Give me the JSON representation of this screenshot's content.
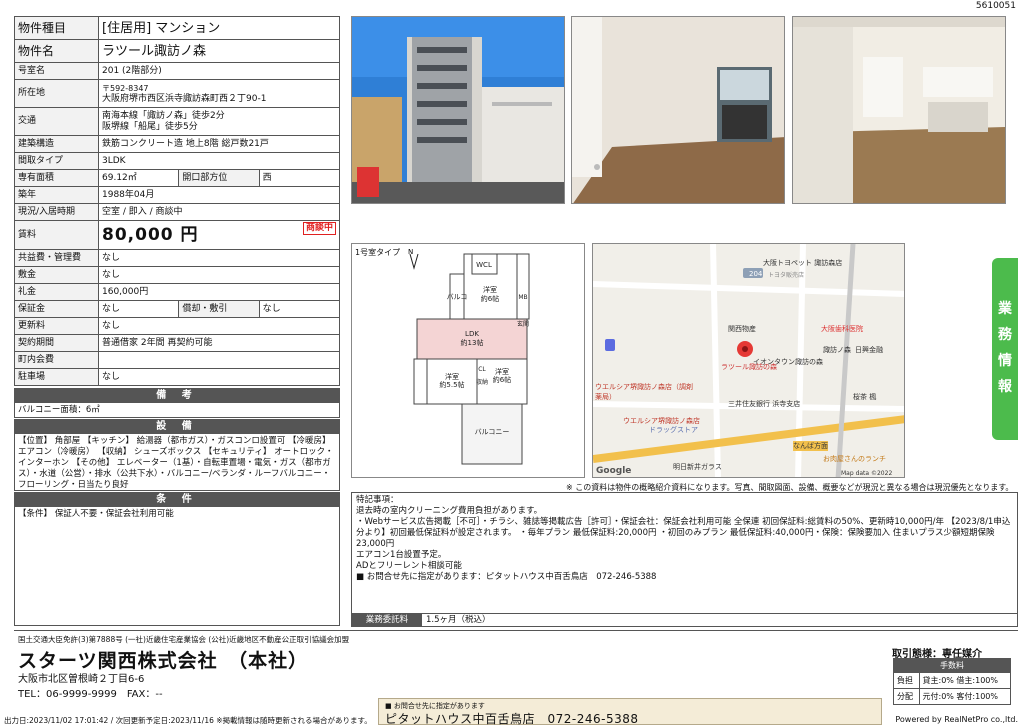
{
  "doc_id": "5610051",
  "property": {
    "type_label": "物件種目",
    "type_value": "[住居用] マンション",
    "name_label": "物件名",
    "name_value": "ラツール諏訪ノ森",
    "room_label": "号室名",
    "room_value": "201 (2階部分)",
    "address_label": "所在地",
    "zip": "〒592-8347",
    "address_value": "大阪府堺市西区浜寺諏訪森町西２丁90-1",
    "transport_label": "交通",
    "transport_1": "南海本線「諏訪ノ森」徒歩2分",
    "transport_2": "阪堺線「船尾」徒歩5分",
    "structure_label": "建築構造",
    "structure_value": "鉄筋コンクリート造 地上8階 総戸数21戸",
    "layout_label": "間取タイプ",
    "layout_value": "3LDK",
    "area_label": "専有面積",
    "area_value": "69.12㎡",
    "opening_label": "開口部方位",
    "opening_value": "西",
    "built_label": "築年",
    "built_value": "1988年04月",
    "status_label": "現況/入居時期",
    "status_value": "空室 / 即入 / 商談中",
    "rent_label": "賃料",
    "rent_value": "80,000 円",
    "rent_badge": "商談中",
    "mgmt_label": "共益費・管理費",
    "mgmt_value": "なし",
    "deposit_label": "敷金",
    "deposit_value": "なし",
    "keymoney_label": "礼金",
    "keymoney_value": "160,000円",
    "guarantee_label": "保証金",
    "guarantee_value": "なし",
    "amort_label": "償却・敷引",
    "amort_value": "なし",
    "renewal_label": "更新料",
    "renewal_value": "なし",
    "contract_label": "契約期間",
    "contract_value": "普通借家 2年間 再契約可能",
    "town_label": "町内会費",
    "town_value": "",
    "parking_label": "駐車場",
    "parking_value": "なし"
  },
  "remarks_section": {
    "title": "備 考",
    "body": "バルコニー面積：6㎡"
  },
  "facilities_section": {
    "title": "設 備",
    "body": "【位置】 角部屋 【キッチン】 給湯器（都市ガス）・ガスコンロ設置可 【冷暖房】 エアコン（冷暖房） 【収納】 シューズボックス 【セキュリティ】 オートロック・インターホン 【その他】 エレベーター（1基）・自転車置場・電気・ガス（都市ガス）・水道（公営）・排水（公共下水）・バルコニー/ベランダ・ルーフバルコニー・フローリング・日当たり良好"
  },
  "conditions_section": {
    "title": "条 件",
    "body": "【条件】 保証人不要・保証会社利用可能"
  },
  "floor_plan": {
    "type_label": "1号室タイプ",
    "rooms": {
      "wcl": "WCL",
      "western1": "洋室\n約6帖",
      "ldk": "LDK\n約13帖",
      "western2": "洋室\n約5.5帖",
      "western3": "洋室\n約6帖",
      "balcony": "バルコニー",
      "balcony_side": "バルコニー",
      "entrance": "玄関",
      "cl": "CL",
      "storage": "収納",
      "mb": "MB"
    }
  },
  "map": {
    "labels": [
      "大阪トヨペット 諏訪森店",
      "トヨタ販売店",
      "関西物産",
      "大阪歯科医院",
      "日興金融",
      "イオンタウン諏訪の森",
      "諏訪ノ森",
      "ラツール諏訪の森",
      "ウエルシア堺諏訪ノ森店（調剤薬局）",
      "三井住友銀行 浜寺支店",
      "ウエルシア堺諏訪ノ森店",
      "ドラッグストア",
      "桜茶 楓",
      "なんば方面",
      "お肉屋さんのランチ",
      "明日新井ガラス",
      "Google",
      "Map data ©2022"
    ],
    "road_badge": "204"
  },
  "disclaimer": "※ この資料は物件の概略紹介資料になります。写真、間取図面、設備、概要などが現況と異なる場合は現況優先となります。",
  "sidebar_text": "業務情報",
  "special_notes": {
    "lines": [
      "特記事項：",
      "退去時の室内クリーニング費用負担があります。",
      "・Webサービス広告掲載［不可］・チラシ、雑誌等掲載広告［許可］・保証会社：保証会社利用可能 全保連 初回保証料:総賃料の50%、更新時10,000円/年 【2023/8/1申込分より】初回最低保証料が設定されます。 ・毎年プラン 最低保証料:20,000円 ・初回のみプラン 最低保証料:40,000円・保険：保険要加入 住まいプラス少額短期保険 23,000円",
      "エアコン1台設置予定。",
      "ADとフリーレント相談可能",
      "■ お問合せ先に指定があります：ピタットハウス中百舌鳥店　072-246-5388"
    ]
  },
  "commission": {
    "label": "業務委託料",
    "value": "1.5ヶ月（税込）"
  },
  "company": {
    "license": "国土交通大臣免許(3)第7888号 (一社)近畿住宅産業協会 (公社)近畿地区不動産公正取引協議会加盟",
    "name": "スターツ関西株式会社　（本社）",
    "address": "大阪市北区曽根崎２丁目6-6",
    "tel": "TEL：06-9999-9999　FAX：--"
  },
  "transaction": {
    "mode": "取引態様：専任媒介",
    "fee_header": "手数料",
    "burden_label": "負担",
    "burden_value": "貸主:0% 借主:100%",
    "split_label": "分配",
    "split_value": "元付:0% 客付:100%"
  },
  "contact": {
    "small": "■ お問合せ先に指定があります",
    "big": "ピタットハウス中百舌鳥店　072-246-5388"
  },
  "footer": "出力日:2023/11/02 17:01:42 / 次回更新予定日:2023/11/16 ※掲載情報は随時更新される場合があります。",
  "powered": "Powered by RealNetPro co.,ltd."
}
